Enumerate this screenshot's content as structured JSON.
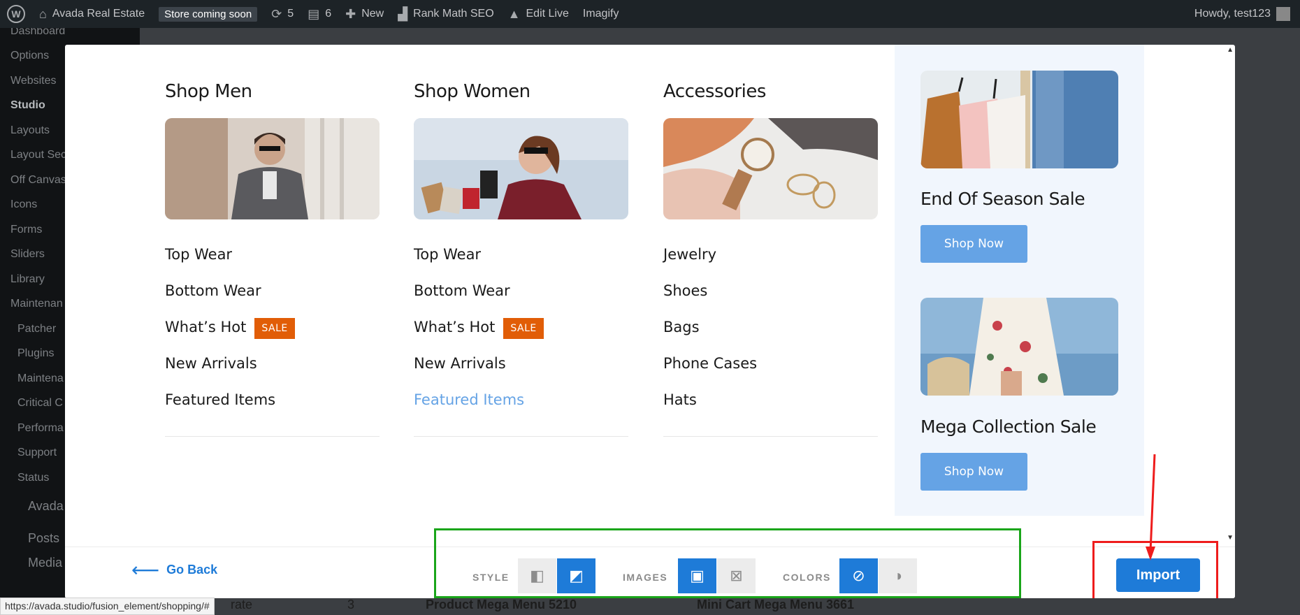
{
  "adminbar": {
    "site_name": "Avada Real Estate",
    "store_badge": "Store coming soon",
    "updates_count": "5",
    "comments_count": "6",
    "new_label": "New",
    "rankmath_label": "Rank Math SEO",
    "editlive_label": "Edit Live",
    "imagify_label": "Imagify",
    "howdy": "Howdy, test123"
  },
  "sidebar": {
    "items": [
      "Dashboard",
      "Options",
      "Websites",
      "Studio",
      "Layouts",
      "Layout Sec",
      "Off Canvas",
      "Icons",
      "Forms",
      "Sliders",
      "Library",
      "Maintenan"
    ],
    "subitems": [
      "Patcher",
      "Plugins",
      "Maintena",
      "Critical C",
      "Performa",
      "Support",
      "Status"
    ],
    "avada": "Avada",
    "posts": "Posts",
    "media": "Media"
  },
  "behind": {
    "text1": "rate",
    "count": "3",
    "card1": "Product Mega Menu 5210",
    "card2": "Mini Cart Mega Menu 3661"
  },
  "columns": [
    {
      "title": "Shop Men",
      "items": [
        "Top Wear",
        "Bottom Wear",
        "What’s Hot",
        "New Arrivals",
        "Featured Items"
      ],
      "sale_on": 2
    },
    {
      "title": "Shop Women",
      "items": [
        "Top Wear",
        "Bottom Wear",
        "What’s Hot",
        "New Arrivals",
        "Featured Items"
      ],
      "sale_on": 2
    },
    {
      "title": "Accessories",
      "items": [
        "Jewelry",
        "Shoes",
        "Bags",
        "Phone Cases",
        "Hats"
      ]
    }
  ],
  "sale_badge": "SALE",
  "promo": {
    "title1": "End Of Season Sale",
    "title2": "Mega Collection Sale",
    "button": "Shop Now"
  },
  "footer": {
    "go_back": "Go Back",
    "style_label": "STYLE",
    "images_label": "IMAGES",
    "colors_label": "COLORS",
    "import": "Import"
  },
  "status_url": "https://avada.studio/fusion_element/shopping/#",
  "colors": {
    "accent": "#1e7bd8",
    "sale": "#e15d07",
    "promo_btn": "#65a3e5",
    "highlight_green": "#1aa51a",
    "highlight_red": "#ee1c1c"
  }
}
